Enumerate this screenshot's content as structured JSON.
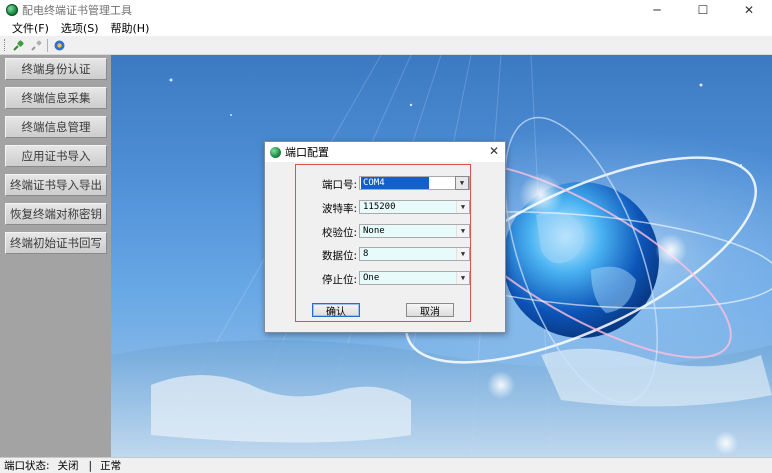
{
  "window": {
    "title": "配电终端证书管理工具"
  },
  "menu": {
    "items": [
      "文件(F)",
      "选项(S)",
      "帮助(H)"
    ]
  },
  "sidebar": {
    "items": [
      "终端身份认证",
      "终端信息采集",
      "终端信息管理",
      "应用证书导入",
      "终端证书导入导出",
      "恢复终端对称密钥",
      "终端初始证书回写"
    ]
  },
  "dialog": {
    "title": "端口配置",
    "fields": [
      {
        "label": "端口号:",
        "value": "COM4"
      },
      {
        "label": "波特率:",
        "value": "115200"
      },
      {
        "label": "校验位:",
        "value": "None"
      },
      {
        "label": "数据位:",
        "value": "8"
      },
      {
        "label": "停止位:",
        "value": "One"
      }
    ],
    "ok_label": "确认",
    "cancel_label": "取消"
  },
  "status": {
    "port_label": "端口状态:",
    "port_value": "关闭",
    "separator": "|",
    "state": "正常"
  },
  "colors": {
    "accent": "#1560c8",
    "frame_red": "#e05050",
    "sidebar": "#a3a3a3"
  },
  "icons": [
    "app-globe-icon",
    "connect-icon",
    "disconnect-icon",
    "settings-icon",
    "minimize-icon",
    "maximize-icon",
    "close-icon",
    "chevron-down-icon"
  ]
}
